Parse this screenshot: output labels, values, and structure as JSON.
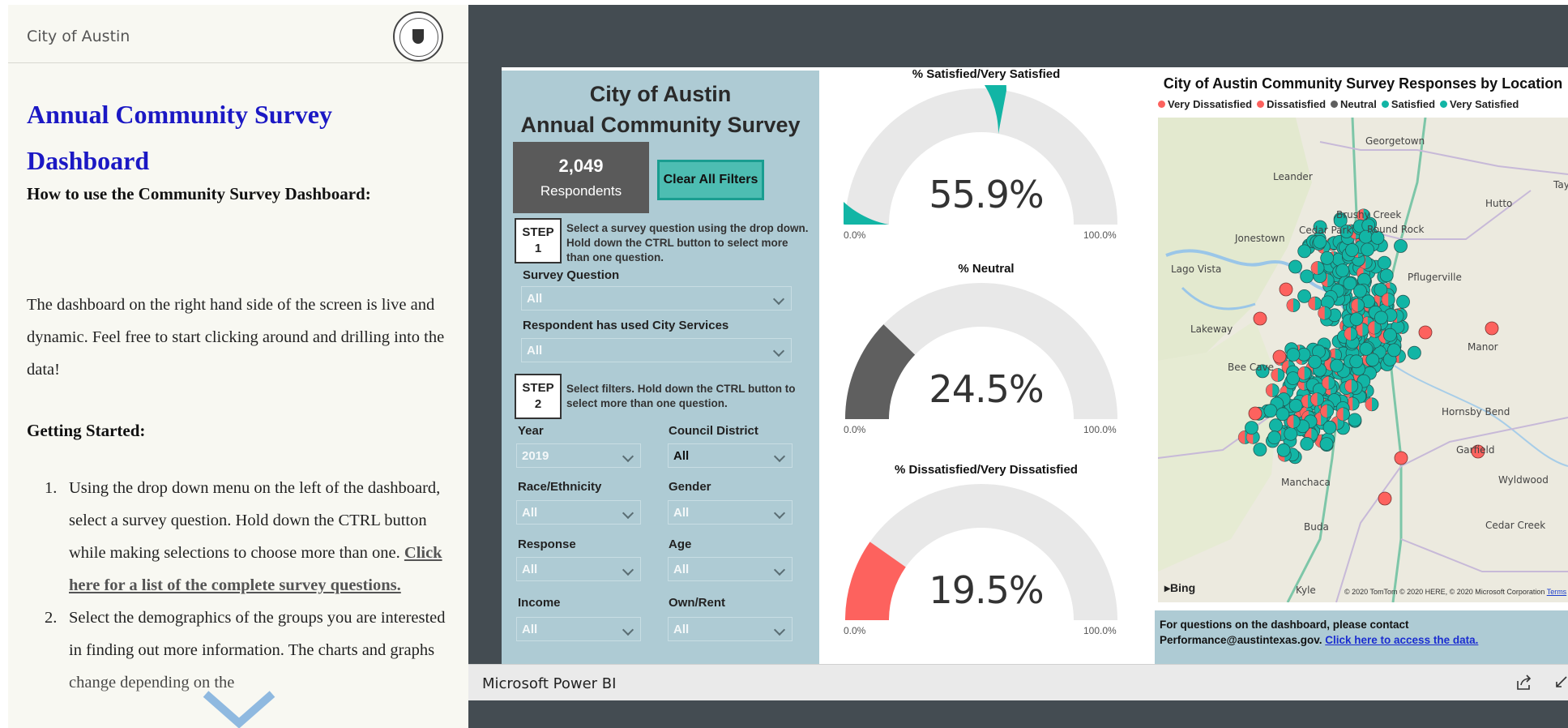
{
  "left": {
    "site_title": "City of Austin",
    "page_title": "Annual Community Survey Dashboard",
    "how_to_heading": "How to use the Community Survey Dashboard:",
    "intro": "The dashboard on the right hand side of the screen is live and dynamic. Feel free to start clicking around and drilling into the data!",
    "getting_started": "Getting Started:",
    "steps": [
      {
        "num": "1.",
        "text": "Using the drop down menu on the left of the dashboard, select a survey question. Hold down the CTRL button while making selections to choose more than one.",
        "link": "Click here for a list of the complete survey questions."
      },
      {
        "num": "2.",
        "text": "Select the demographics of the groups you are interested in finding out more information. The charts and graphs change depending on the"
      }
    ]
  },
  "pbi": {
    "brand": "Microsoft Power BI",
    "filter_panel": {
      "title_line1": "City of Austin",
      "title_line2": "Annual Community Survey",
      "respondents_count": "2,049",
      "respondents_label": "Respondents",
      "clear_filters": "Clear All Filters",
      "step1_label": "STEP",
      "step1_num": "1",
      "step1_text": "Select a survey question using the drop down. Hold down the CTRL button to select more than one question.",
      "step2_label": "STEP",
      "step2_num": "2",
      "step2_text": "Select filters. Hold down the CTRL button to select more than one question.",
      "survey_question_label": "Survey Question",
      "survey_question_value": "All",
      "used_services_label": "Respondent has used City Services",
      "used_services_value": "All",
      "year_label": "Year",
      "year_value": "2019",
      "council_label": "Council District",
      "council_value": "All",
      "race_label": "Race/Ethnicity",
      "race_value": "All",
      "gender_label": "Gender",
      "gender_value": "All",
      "response_label": "Response",
      "response_value": "All",
      "age_label": "Age",
      "age_value": "All",
      "income_label": "Income",
      "income_value": "All",
      "own_label": "Own/Rent",
      "own_value": "All"
    },
    "gauges": [
      {
        "title": "% Satisfied/Very Satisfied",
        "value_text": "55.9%",
        "value": 55.9,
        "min": "0.0%",
        "max": "100.0%",
        "color": "#12b5a5"
      },
      {
        "title": "% Neutral",
        "value_text": "24.5%",
        "value": 24.5,
        "min": "0.0%",
        "max": "100.0%",
        "color": "#5f5f5f"
      },
      {
        "title": "% Dissatisfied/Very Dissatisfied",
        "value_text": "19.5%",
        "value": 19.5,
        "min": "0.0%",
        "max": "100.0%",
        "color": "#fd625e"
      }
    ],
    "map": {
      "title": "City of Austin Community Survey Responses by Location",
      "legend": [
        {
          "label": "Very Dissatisfied",
          "color": "#fd625e"
        },
        {
          "label": "Dissatisfied",
          "color": "#fd625e"
        },
        {
          "label": "Neutral",
          "color": "#5f5f5f"
        },
        {
          "label": "Satisfied",
          "color": "#12b5a5"
        },
        {
          "label": "Very Satisfied",
          "color": "#12b5a5"
        }
      ],
      "places": [
        "Georgetown",
        "Leander",
        "Hutto",
        "Brushy Creek",
        "Round Rock",
        "Cedar Park",
        "Jonestown",
        "Lago Vista",
        "Pflugerville",
        "Lakeway",
        "Manor",
        "Bee Cave",
        "Hornsby Bend",
        "Garfield",
        "Manchaca",
        "Wyldwood",
        "Buda",
        "Cedar Creek",
        "Kyle",
        "Tay"
      ],
      "bing": "Bing",
      "credit": "© 2020 TomTom © 2020 HERE, © 2020 Microsoft Corporation",
      "terms": "Terms",
      "footer_text": "For questions on the dashboard, please contact Performance@austintexas.gov.",
      "footer_link": "Click here to access the data."
    }
  }
}
